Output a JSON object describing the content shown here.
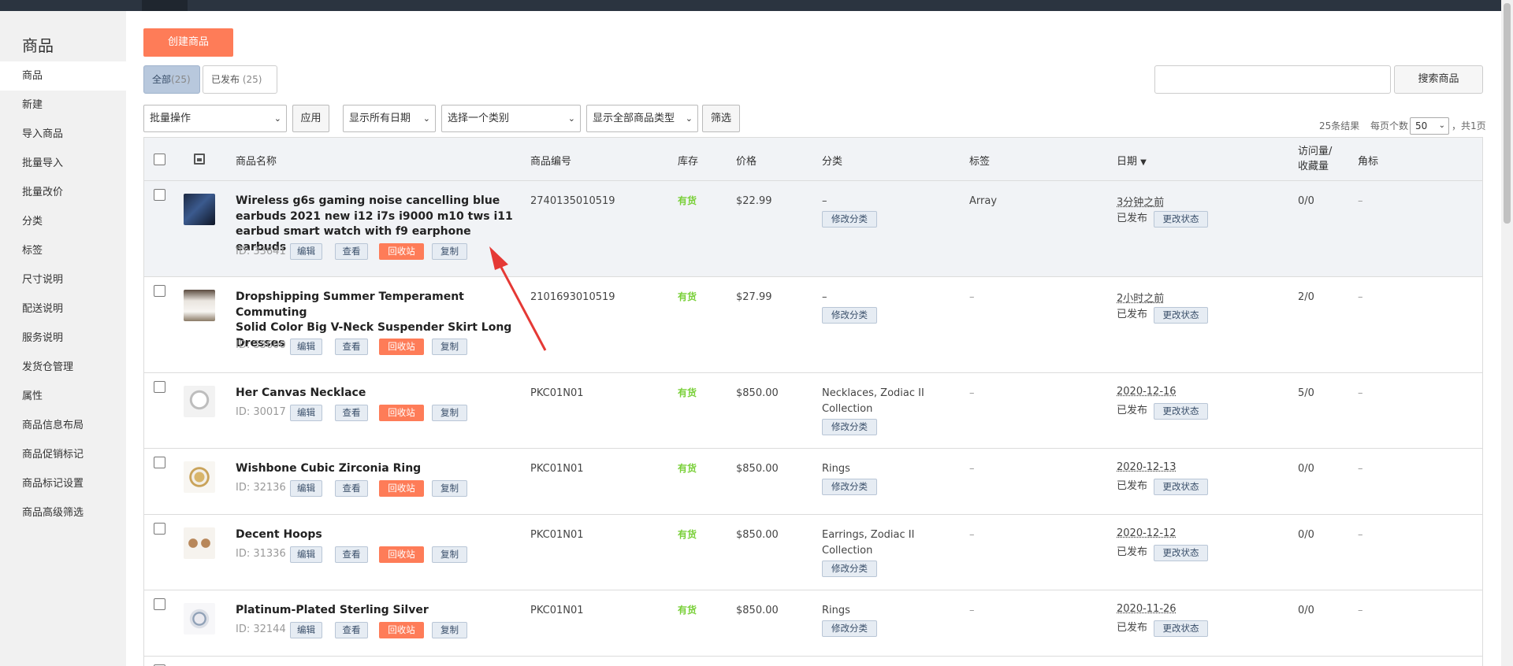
{
  "sidebar": {
    "title": "商品",
    "items": [
      {
        "label": "商品"
      },
      {
        "label": "新建"
      },
      {
        "label": "导入商品"
      },
      {
        "label": "批量导入"
      },
      {
        "label": "批量改价"
      },
      {
        "label": "分类"
      },
      {
        "label": "标签"
      },
      {
        "label": "尺寸说明"
      },
      {
        "label": "配送说明"
      },
      {
        "label": "服务说明"
      },
      {
        "label": "发货仓管理"
      },
      {
        "label": "属性"
      },
      {
        "label": "商品信息布局"
      },
      {
        "label": "商品促销标记"
      },
      {
        "label": "商品标记设置"
      },
      {
        "label": "商品高级筛选"
      }
    ]
  },
  "toolbar": {
    "create_label": "创建商品",
    "tabs": [
      {
        "label": "全部",
        "count": "(25)"
      },
      {
        "label": "已发布",
        "count": "(25)"
      }
    ],
    "search_button": "搜索商品",
    "bulk_action": "批量操作",
    "apply": "应用",
    "date_filter": "显示所有日期",
    "category_filter": "选择一个类别",
    "type_filter": "显示全部商品类型",
    "filter_button": "筛选",
    "results": "25条结果",
    "per_page_label": "每页个数",
    "per_page_value": "50",
    "pages": "，共1页"
  },
  "table": {
    "headers": {
      "name": "商品名称",
      "sku": "商品编号",
      "stock": "库存",
      "price": "价格",
      "category": "分类",
      "tags": "标签",
      "date": "日期",
      "date_sort": "▼",
      "visits_1": "访问量/",
      "visits_2": "收藏量",
      "badge": "角标"
    },
    "action_labels": {
      "edit": "编辑",
      "view": "查看",
      "trash": "回收站",
      "copy": "复制",
      "edit_category": "修改分类",
      "change_status": "更改状态",
      "published": "已发布"
    },
    "rows": [
      {
        "name_lines": [
          "Wireless g6s gaming noise cancelling blue",
          "earbuds 2021 new i12 i7s i9000 m10 tws i11",
          "earbud smart watch with f9 earphone earbuds"
        ],
        "id": "ID: 33641",
        "sku": "2740135010519",
        "stock": "有货",
        "price": "$22.99",
        "category_lines": [
          "–"
        ],
        "tags": "Array",
        "date": "3分钟之前",
        "visits": "0/0",
        "badge": "–"
      },
      {
        "name_lines": [
          "Dropshipping Summer Temperament Commuting",
          "Solid Color Big V-Neck Suspender Skirt Long",
          "Dresses"
        ],
        "id": "ID: 33600",
        "sku": "2101693010519",
        "stock": "有货",
        "price": "$27.99",
        "category_lines": [
          "–"
        ],
        "tags": "–",
        "date": "2小时之前",
        "visits": "2/0",
        "badge": "–"
      },
      {
        "name_lines": [
          "Her Canvas Necklace"
        ],
        "id": "ID: 30017",
        "sku": "PKC01N01",
        "stock": "有货",
        "price": "$850.00",
        "category_lines": [
          "Necklaces, Zodiac II",
          "Collection"
        ],
        "tags": "–",
        "date": "2020-12-16",
        "visits": "5/0",
        "badge": "–"
      },
      {
        "name_lines": [
          "Wishbone Cubic Zirconia Ring"
        ],
        "id": "ID: 32136",
        "sku": "PKC01N01",
        "stock": "有货",
        "price": "$850.00",
        "category_lines": [
          "Rings"
        ],
        "tags": "–",
        "date": "2020-12-13",
        "visits": "0/0",
        "badge": "–"
      },
      {
        "name_lines": [
          "Decent Hoops"
        ],
        "id": "ID: 31336",
        "sku": "PKC01N01",
        "stock": "有货",
        "price": "$850.00",
        "category_lines": [
          "Earrings, Zodiac II",
          "Collection"
        ],
        "tags": "–",
        "date": "2020-12-12",
        "visits": "0/0",
        "badge": "–"
      },
      {
        "name_lines": [
          "Platinum-Plated Sterling Silver"
        ],
        "id": "ID: 32144",
        "sku": "PKC01N01",
        "stock": "有货",
        "price": "$850.00",
        "category_lines": [
          "Rings"
        ],
        "tags": "–",
        "date": "2020-11-26",
        "visits": "0/0",
        "badge": "–"
      }
    ]
  },
  "colors": {
    "accent": "#fe7c58",
    "stock_green": "#7ad03a",
    "header_bg": "#f1f3f6",
    "sidebar_bg": "#f1f1f1"
  }
}
